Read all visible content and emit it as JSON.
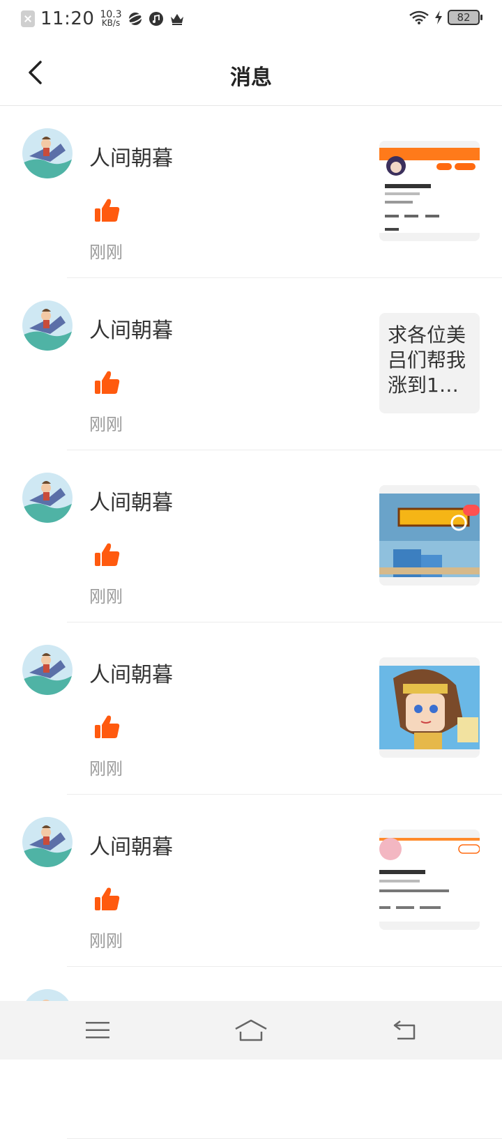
{
  "status_bar": {
    "time": "11:20",
    "speed_value": "10.3",
    "speed_unit": "KB/s",
    "battery": "82"
  },
  "header": {
    "title": "消息",
    "back_icon": "chevron-left-icon"
  },
  "messages": [
    {
      "name": "人间朝暮",
      "time": "刚刚",
      "thumb_type": "profile-screenshot",
      "thumb_text": ""
    },
    {
      "name": "人间朝暮",
      "time": "刚刚",
      "thumb_type": "text",
      "thumb_text": "求各位美吕们帮我涨到1…"
    },
    {
      "name": "人间朝暮",
      "time": "刚刚",
      "thumb_type": "game-banner",
      "thumb_text": ""
    },
    {
      "name": "人间朝暮",
      "time": "刚刚",
      "thumb_type": "character-art",
      "thumb_text": ""
    },
    {
      "name": "人间朝暮",
      "time": "刚刚",
      "thumb_type": "profile-screenshot",
      "thumb_text": ""
    }
  ],
  "colors": {
    "accent": "#ff5a0f",
    "muted_text": "#9a9a9a",
    "divider": "#ececec"
  },
  "nav": {
    "menu_icon": "menu-icon",
    "home_icon": "home-icon",
    "back_icon": "back-icon"
  }
}
